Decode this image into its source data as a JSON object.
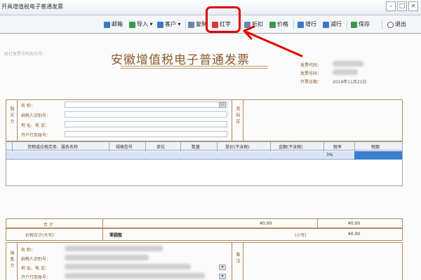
{
  "window": {
    "title": "开具增值税电子普通发票",
    "min": "–",
    "max": "□",
    "close": "×"
  },
  "toolbar": {
    "items": [
      {
        "label": "邮箱",
        "icon": "mail-icon",
        "color": "#3a78c8"
      },
      {
        "label": "导入 ▾",
        "icon": "import-icon",
        "color": "#3a9a4a"
      },
      {
        "label": "客户 ▾",
        "icon": "customer-icon",
        "color": "#3a78c8"
      },
      {
        "label": "复制",
        "icon": "copy-icon",
        "color": "#6b86a8"
      },
      {
        "label": "红字",
        "icon": "red-invoice-icon",
        "color": "#d13b3b"
      },
      {
        "label": "折扣",
        "icon": "discount-icon",
        "color": "#6b86a8"
      },
      {
        "label": "价格",
        "icon": "price-icon",
        "color": "#3a9a4a"
      },
      {
        "label": "增行",
        "icon": "add-row-icon",
        "color": "#3a78c8"
      },
      {
        "label": "减行",
        "icon": "remove-row-icon",
        "color": "#3a78c8"
      },
      {
        "label": "保存",
        "icon": "save-icon",
        "color": "#3a9a4a"
      },
      {
        "label": "退出",
        "icon": "exit-icon",
        "color": "#555555"
      }
    ],
    "highlight_color": "#e00000"
  },
  "invoice": {
    "corner_text": "机打发票号码及代号：",
    "title": "安徽增值税电子普通发票",
    "meta": {
      "code_label": "发票代码：",
      "number_label": "发票号码：",
      "date_label": "开票日期：",
      "date_value": "2019年11月21日"
    },
    "buyer": {
      "side_label": "购买方",
      "fields": [
        "名    称：",
        "纳税人识别号：",
        "地 址、电 话：",
        "开户行及账号："
      ],
      "password_label": "密码区"
    },
    "grid": {
      "columns": [
        "货物或应税劳务、服务名称",
        "规格型号",
        "单位",
        "数量",
        "单价(不含税)",
        "金额(不含税)",
        "税率",
        "税额"
      ],
      "row": {
        "tax_rate": "3%"
      }
    },
    "totals": {
      "label": "合     计",
      "amount": "¥0.00",
      "tax": "¥0.00"
    },
    "price_tax": {
      "label": "价税合计(大写)",
      "uppercase": "零圆整",
      "small_label": "(小写)",
      "small_value": "¥0.00"
    },
    "seller": {
      "side_label": "销售方",
      "fields": [
        "名    称：",
        "纳税人识别号：",
        "地 址、电 话：",
        "开户行及账号："
      ],
      "remark_label": "备注"
    }
  }
}
